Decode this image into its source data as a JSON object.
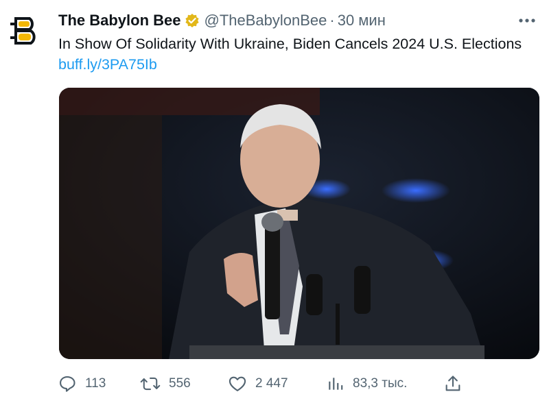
{
  "tweet": {
    "author_name": "The Babylon Bee",
    "handle": "@TheBabylonBee",
    "separator": "·",
    "time": "30 мин",
    "text": "In Show Of Solidarity With Ukraine, Biden Cancels 2024 U.S. Elections",
    "link": "buff.ly/3PA75Ib"
  },
  "icons": {
    "avatar": "babylon-bee-logo",
    "verified": "verified-badge-icon",
    "more": "more-icon",
    "reply": "reply-icon",
    "retweet": "retweet-icon",
    "like": "like-icon",
    "views": "views-icon",
    "share": "share-icon"
  },
  "colors": {
    "verified_badge": "#e2b719",
    "link": "#1d9bf0",
    "muted": "#536471"
  },
  "actions": {
    "replies": "113",
    "retweets": "556",
    "likes": "2 447",
    "views": "83,3 тыс."
  }
}
